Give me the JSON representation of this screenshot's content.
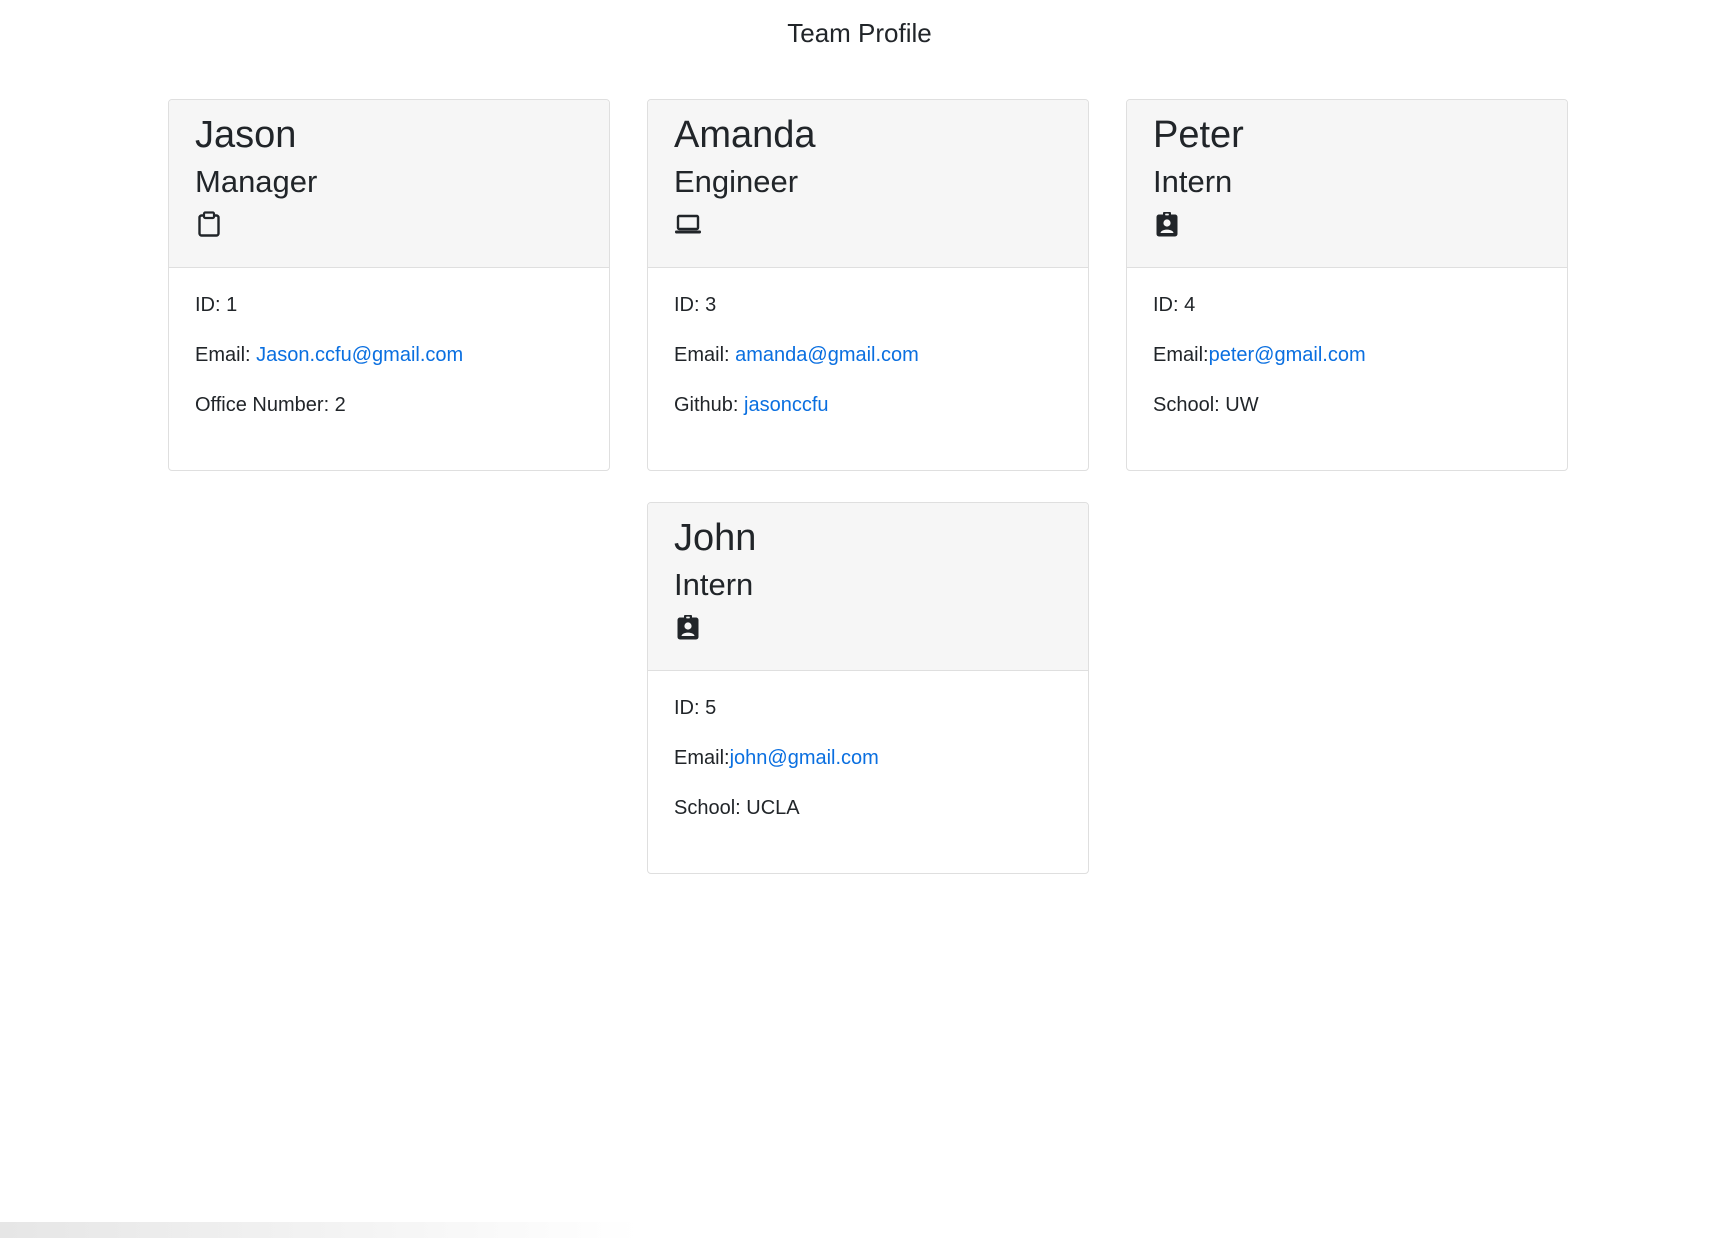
{
  "page": {
    "title": "Team Profile"
  },
  "colors": {
    "link": "#0a6fe0",
    "header_bg": "#f6f6f6",
    "border": "#dfdfdf"
  },
  "cards": [
    {
      "name": "Jason",
      "role": "Manager",
      "icon": "clipboard-icon",
      "id_label": "ID: 1",
      "email_label": "Email: ",
      "email": "Jason.ccfu@gmail.com",
      "extra_label": "Office Number: 2",
      "extra_link": ""
    },
    {
      "name": "Amanda",
      "role": "Engineer",
      "icon": "laptop-icon",
      "id_label": "ID: 3",
      "email_label": "Email: ",
      "email": "amanda@gmail.com",
      "extra_label": "Github: ",
      "extra_link": "jasonccfu"
    },
    {
      "name": "Peter",
      "role": "Intern",
      "icon": "user-badge-icon",
      "id_label": "ID: 4",
      "email_label": "Email:",
      "email": "peter@gmail.com",
      "extra_label": "School: UW",
      "extra_link": ""
    },
    {
      "name": "John",
      "role": "Intern",
      "icon": "user-badge-icon",
      "id_label": "ID: 5",
      "email_label": "Email:",
      "email": "john@gmail.com",
      "extra_label": "School: UCLA",
      "extra_link": ""
    }
  ]
}
